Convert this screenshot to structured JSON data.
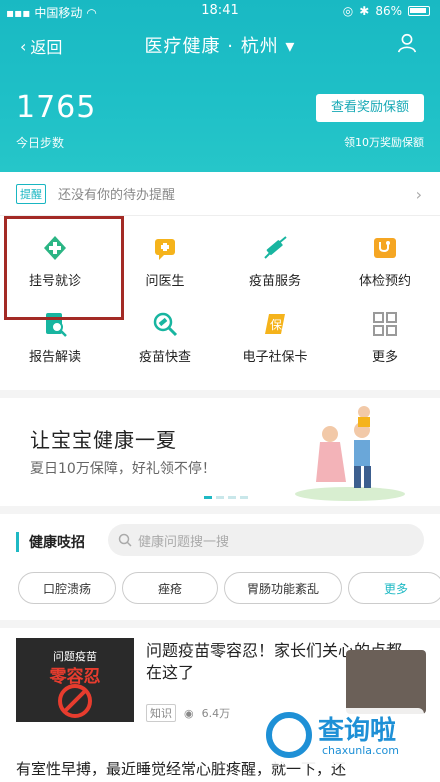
{
  "status_bar": {
    "carrier": "中国移动",
    "time": "18:41",
    "battery": "86%"
  },
  "nav": {
    "back_label": "返回",
    "title": "医疗健康 · 杭州 ▾"
  },
  "steps": {
    "count": "1765",
    "label": "今日步数",
    "reward_button": "查看奖励保额",
    "reward_note": "领10万奖励保额"
  },
  "reminder": {
    "tag": "提醒",
    "text": "还没有你的待办提醒"
  },
  "services": [
    {
      "label": "挂号就诊",
      "icon": "plus-icon",
      "color": "#2bb584"
    },
    {
      "label": "问医生",
      "icon": "chat-icon",
      "color": "#f5b31b"
    },
    {
      "label": "疫苗服务",
      "icon": "syringe-icon",
      "color": "#18b5a0"
    },
    {
      "label": "体检预约",
      "icon": "stethoscope-icon",
      "color": "#f5a623"
    },
    {
      "label": "报告解读",
      "icon": "report-icon",
      "color": "#18b5a0"
    },
    {
      "label": "疫苗快查",
      "icon": "vaccine-search-icon",
      "color": "#18b5a0"
    },
    {
      "label": "电子社保卡",
      "icon": "card-icon",
      "color": "#f5b31b"
    },
    {
      "label": "更多",
      "icon": "grid-icon",
      "color": "#9a9a9a"
    }
  ],
  "banner": {
    "title": "让宝宝健康一夏",
    "subtitle": "夏日10万保障，好礼领不停！"
  },
  "tips": {
    "title": "健康吱招",
    "search_placeholder": "健康问题搜一搜",
    "chips": [
      "口腔溃疡",
      "痤疮",
      "胃肠功能紊乱",
      "更多"
    ]
  },
  "article": {
    "thumb_top": "问题疫苗",
    "thumb_big": "零容忍",
    "title": "问题疫苗零容忍！家长们关心的点都在这了",
    "keyword": "知识",
    "views": "6.4万",
    "next_title": "有室性早搏，最近睡觉经常心脏疼醒，就一下，还"
  },
  "watermark": {
    "brand": "查询啦",
    "domain": "chaxunla.com"
  }
}
